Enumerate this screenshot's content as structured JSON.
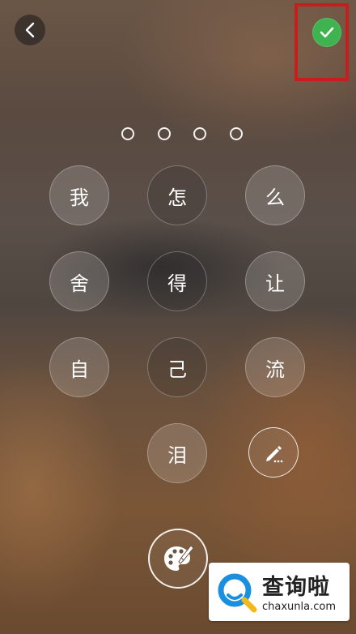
{
  "header": {
    "back_icon": "chevron-left-icon",
    "confirm_icon": "checkmark-icon",
    "confirm_color": "#3fb34f",
    "highlight_color": "#c81d1d"
  },
  "passcode": {
    "length": 4,
    "filled": 0
  },
  "keypad": {
    "keys": [
      "我",
      "怎",
      "么",
      "舍",
      "得",
      "让",
      "自",
      "己",
      "流",
      "泪"
    ],
    "edit_icon": "pencil-icon"
  },
  "theme_button": {
    "icon": "palette-icon"
  },
  "watermark": {
    "text": "查询啦",
    "url": "chaxunla.com",
    "accent": "#1a8fe0"
  }
}
